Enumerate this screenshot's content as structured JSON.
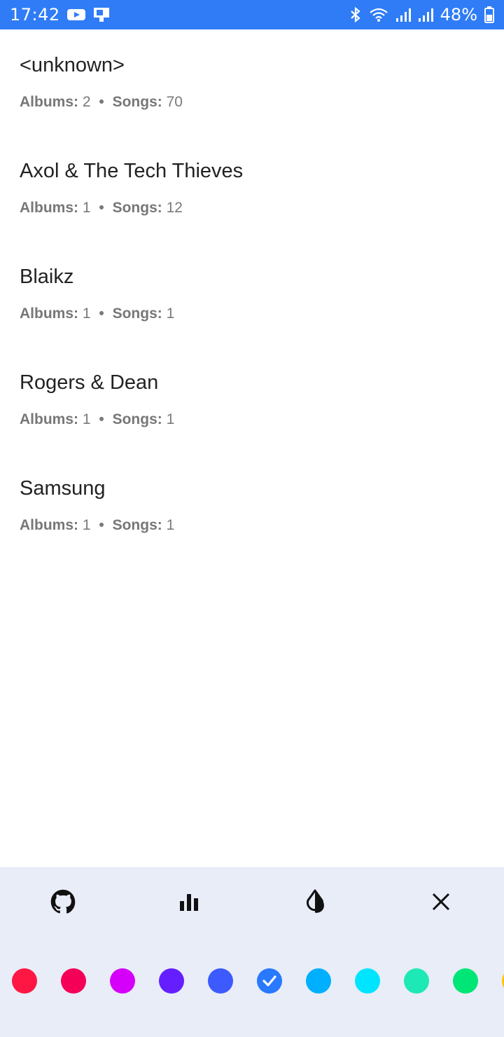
{
  "status_bar": {
    "time": "17:42",
    "battery": "48%",
    "icons": [
      "youtube-icon",
      "screen-cast-icon",
      "bluetooth-icon",
      "wifi-icon",
      "signal-icon",
      "signal-icon",
      "battery-icon"
    ]
  },
  "artists": [
    {
      "name": "<unknown>",
      "albums_label": "Albums:",
      "albums": "2",
      "songs_label": "Songs:",
      "songs": "70"
    },
    {
      "name": "Axol & The Tech Thieves",
      "albums_label": "Albums:",
      "albums": "1",
      "songs_label": "Songs:",
      "songs": "12"
    },
    {
      "name": "Blaikz",
      "albums_label": "Albums:",
      "albums": "1",
      "songs_label": "Songs:",
      "songs": "1"
    },
    {
      "name": "Rogers & Dean",
      "albums_label": "Albums:",
      "albums": "1",
      "songs_label": "Songs:",
      "songs": "1"
    },
    {
      "name": "Samsung",
      "albums_label": "Albums:",
      "albums": "1",
      "songs_label": "Songs:",
      "songs": "1"
    }
  ],
  "separator": "•",
  "toolbar": {
    "icons": [
      "github-icon",
      "bar-chart-icon",
      "contrast-drop-icon",
      "close-icon"
    ]
  },
  "accent_colors": [
    "#ff1744",
    "#f50057",
    "#d500f9",
    "#651fff",
    "#3d5afe",
    "#2979ff",
    "#00b0ff",
    "#00e5ff",
    "#1de9b6",
    "#00e676",
    "#ffc400"
  ],
  "selected_color": "#2979ff",
  "theme": {
    "status_bar": "#2f7cf6",
    "panel_bg": "#e8edf8"
  }
}
